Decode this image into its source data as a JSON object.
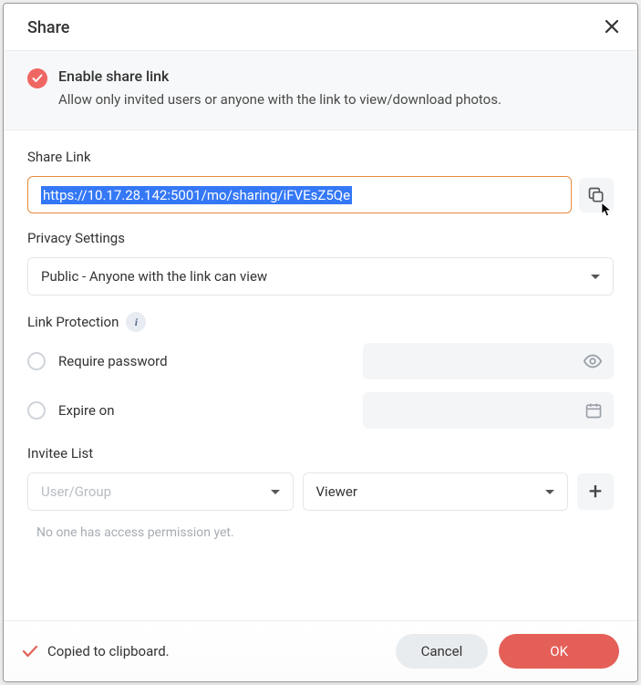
{
  "title": "Share",
  "enable": {
    "title": "Enable share link",
    "description": "Allow only invited users or anyone with the link to view/download photos."
  },
  "share_link": {
    "label": "Share Link",
    "value": "https://10.17.28.142:5001/mo/sharing/iFVEsZ5Qe"
  },
  "privacy": {
    "label": "Privacy Settings",
    "selected": "Public - Anyone with the link can view"
  },
  "protection": {
    "label": "Link Protection",
    "password_label": "Require password",
    "expire_label": "Expire on"
  },
  "invitee": {
    "label": "Invitee List",
    "user_placeholder": "User/Group",
    "role_selected": "Viewer",
    "empty_message": "No one has access permission yet."
  },
  "toast": "Copied to clipboard.",
  "buttons": {
    "cancel": "Cancel",
    "ok": "OK"
  }
}
